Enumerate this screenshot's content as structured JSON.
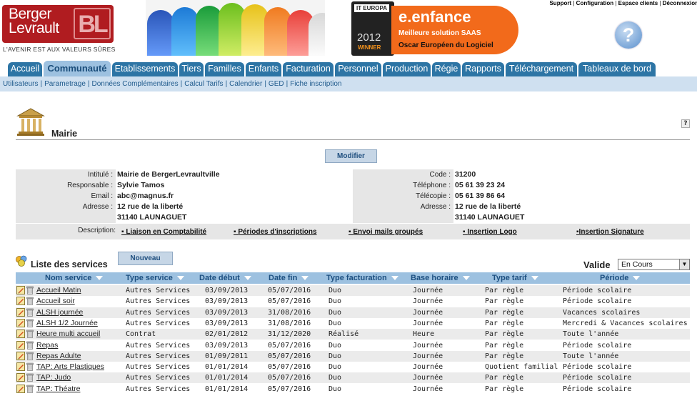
{
  "branding": {
    "logo_line1": "Berger",
    "logo_line2": "Levrault",
    "logo_mark": "BL",
    "tagline": "L'AVENIR EST AUX VALEURS SÛRES",
    "accent_color": "#b01c20"
  },
  "award": {
    "itbadge": "IT EUROPA",
    "year": "2012",
    "winner": "WINNER",
    "product": "e.enfance",
    "line1": "Meilleure solution SAAS",
    "line2": "Oscar Européen du Logiciel"
  },
  "top_links": [
    "Support",
    "Configuration",
    "Espace clients",
    "Déconnexion"
  ],
  "help_icon": "question-circle-icon",
  "tabs": [
    {
      "label": "Accueil",
      "active": false
    },
    {
      "label": "Communauté",
      "active": true
    },
    {
      "label": "Etablissements",
      "active": false
    },
    {
      "label": "Tiers",
      "active": false
    },
    {
      "label": "Familles",
      "active": false
    },
    {
      "label": "Enfants",
      "active": false
    },
    {
      "label": "Facturation",
      "active": false
    },
    {
      "label": "Personnel",
      "active": false
    },
    {
      "label": "Production",
      "active": false
    },
    {
      "label": "Régie",
      "active": false
    },
    {
      "label": "Rapports",
      "active": false
    },
    {
      "label": "Téléchargement",
      "active": false
    },
    {
      "label": "Tableaux de bord",
      "active": false
    }
  ],
  "subnav": [
    "Utilisateurs",
    "Parametrage",
    "Données Complémentaires",
    "Calcul Tarifs",
    "Calendrier",
    "GED",
    "Fiche inscription"
  ],
  "page": {
    "title": "Mairie",
    "help": "?",
    "modify_button": "Modifier"
  },
  "info": {
    "intitule_label": "Intitulé :",
    "intitule": "Mairie de BergerLevraultville",
    "responsable_label": "Responsable :",
    "responsable": "Sylvie Tamos",
    "email_label": "Email :",
    "email": "abc@magnus.fr",
    "adresse_label": "Adresse :",
    "adresse_l1": "12 rue de la liberté",
    "adresse_l2": "31140 LAUNAGUET",
    "code_label": "Code :",
    "code": "31200",
    "telephone_label": "Téléphone :",
    "telephone": "05 61 39 23 24",
    "telecopie_label": "Télécopie :",
    "telecopie": "05 61 39 86 64",
    "adresse2_label": "Adresse :",
    "adresse2_l1": "12 rue de la liberté",
    "adresse2_l2": "31140 LAUNAGUET",
    "description_label": "Description:",
    "description_links": [
      "Liaison en Comptabilité",
      "Périodes d'inscriptions",
      "Envoi mails groupés",
      "Insertion Logo",
      "Insertion Signature"
    ]
  },
  "services": {
    "title": "Liste des services",
    "new_button": "Nouveau",
    "filter_label": "Valide",
    "filter_value": "En Cours",
    "columns": [
      "Nom service",
      "Type service",
      "Date début",
      "Date fin",
      "Type facturation",
      "Base horaire",
      "Type tarif",
      "Période"
    ],
    "rows": [
      [
        "Accueil Matin",
        "Autres Services",
        "03/09/2013",
        "05/07/2016",
        "Duo",
        "Journée",
        "Par règle",
        "Période scolaire"
      ],
      [
        "Accueil soir",
        "Autres Services",
        "03/09/2013",
        "05/07/2016",
        "Duo",
        "Journée",
        "Par règle",
        "Période scolaire"
      ],
      [
        "ALSH journée",
        "Autres Services",
        "03/09/2013",
        "31/08/2016",
        "Duo",
        "Journée",
        "Par règle",
        "Vacances scolaires"
      ],
      [
        "ALSH 1/2 Journée",
        "Autres Services",
        "03/09/2013",
        "31/08/2016",
        "Duo",
        "Journée",
        "Par règle",
        "Mercredi & Vacances scolaires"
      ],
      [
        "Heure multi accueil",
        "Contrat",
        "02/01/2012",
        "31/12/2020",
        "Réalisé",
        "Heure",
        "Par règle",
        "Toute l'année"
      ],
      [
        "Repas",
        "Autres Services",
        "03/09/2013",
        "05/07/2016",
        "Duo",
        "Journée",
        "Par règle",
        "Période scolaire"
      ],
      [
        "Repas Adulte",
        "Autres Services",
        "01/09/2011",
        "05/07/2016",
        "Duo",
        "Journée",
        "Par règle",
        "Toute l'année"
      ],
      [
        "TAP: Arts Plastiques",
        "Autres Services",
        "01/01/2014",
        "05/07/2016",
        "Duo",
        "Journée",
        "Quotient familial",
        "Période scolaire"
      ],
      [
        "TAP: Judo",
        "Autres Services",
        "01/01/2014",
        "05/07/2016",
        "Duo",
        "Journée",
        "Par règle",
        "Période scolaire"
      ],
      [
        "TAP: Théatre",
        "Autres Services",
        "01/01/2014",
        "05/07/2016",
        "Duo",
        "Journée",
        "Par règle",
        "Période scolaire"
      ]
    ]
  },
  "colors": {
    "tab_bg": "#2d75a5",
    "tab_active_bg": "#9dc1e0",
    "subnav_bg": "#cfe0f0",
    "header_row_bg": "#9dc1e0",
    "stripe_bg": "#ebebeb"
  }
}
